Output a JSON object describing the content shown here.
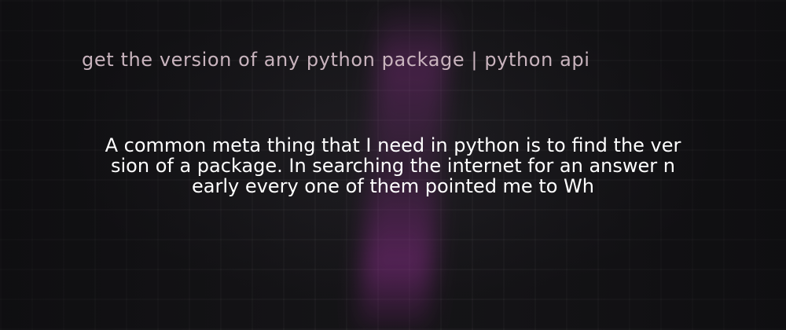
{
  "title": "get the version of any python package | python api",
  "description": {
    "lines": [
      "A common meta thing that I need in python is to find the ver",
      "sion of a package. In searching the internet for an answer n",
      "early every one of them pointed me to Wh"
    ]
  },
  "colors": {
    "background": "#151417",
    "title": "#c9b4be",
    "description": "#ffffff",
    "accent_streak": "#9a329a"
  }
}
